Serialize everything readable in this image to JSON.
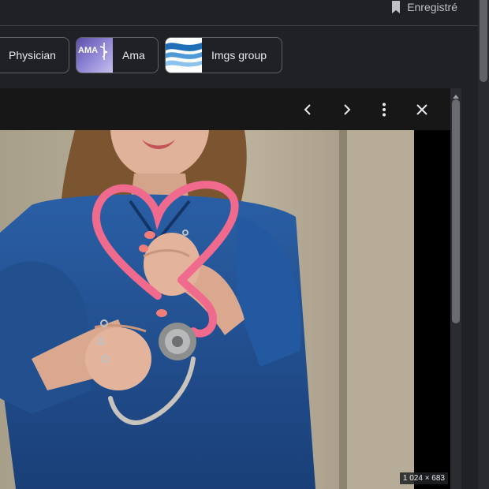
{
  "header": {
    "saved_label": "Enregistré",
    "saved_icon": "bookmark-icon"
  },
  "chips": [
    {
      "label": "Physician"
    },
    {
      "label": "Ama",
      "thumb_text": "AMA"
    },
    {
      "label": "Imgs group"
    }
  ],
  "viewer": {
    "toolbar_icons": [
      "chevron-left-icon",
      "chevron-right-icon",
      "more-vert-icon",
      "close-icon"
    ],
    "image_dimensions": "1 024 × 683",
    "image_subject": "woman holding pink stethoscope in heart shape"
  },
  "colors": {
    "background": "#202124",
    "viewer_background": "#171717",
    "chip_border": "#5f6368",
    "stethoscope_pink": "#f06a8e",
    "scrubs_blue": "#1f4f8f"
  }
}
